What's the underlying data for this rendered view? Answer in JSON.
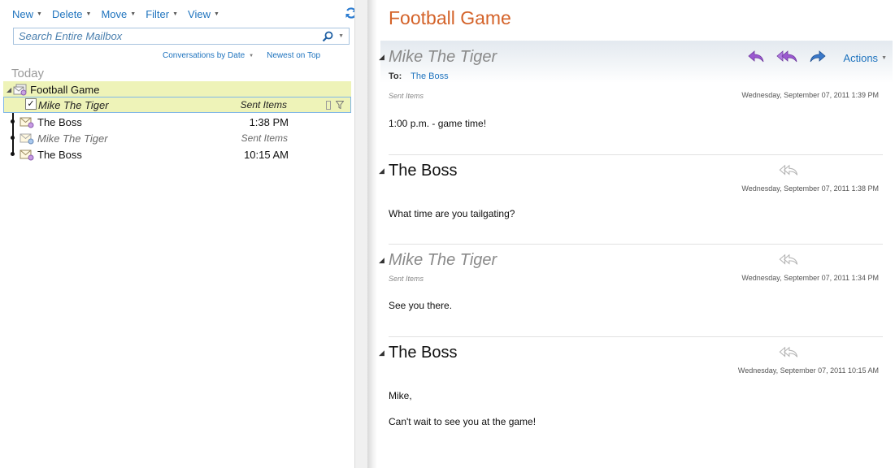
{
  "toolbar": {
    "new_label": "New",
    "delete_label": "Delete",
    "move_label": "Move",
    "filter_label": "Filter",
    "view_label": "View"
  },
  "search": {
    "placeholder": "Search Entire Mailbox"
  },
  "sortbar": {
    "arrange_label": "Conversations by Date",
    "order_label": "Newest on Top"
  },
  "list": {
    "group_label": "Today",
    "conversation_title": "Football Game",
    "messages": [
      {
        "sender": "Mike The Tiger",
        "meta": "Sent Items"
      },
      {
        "sender": "The Boss",
        "meta": "1:38 PM"
      },
      {
        "sender": "Mike The Tiger",
        "meta": "Sent Items"
      },
      {
        "sender": "The Boss",
        "meta": "10:15 AM"
      }
    ]
  },
  "reading": {
    "title": "Football Game",
    "actions_label": "Actions",
    "messages": [
      {
        "sender": "Mike The Tiger",
        "to_label": "To:",
        "to_value": "The Boss",
        "folder": "Sent Items",
        "date": "Wednesday, September 07, 2011 1:39 PM",
        "body": "1:00 p.m. - game time!"
      },
      {
        "sender": "The Boss",
        "date": "Wednesday, September 07, 2011 1:38 PM",
        "body": "What time are you tailgating?"
      },
      {
        "sender": "Mike The Tiger",
        "folder": "Sent Items",
        "date": "Wednesday, September 07, 2011 1:34 PM",
        "body": "See you there."
      },
      {
        "sender": "The Boss",
        "date": "Wednesday, September 07, 2011 10:15 AM",
        "body_line1": "Mike,",
        "body_line2": "Can't wait to see you at the game!"
      }
    ]
  },
  "colors": {
    "accent_blue": "#1e73be",
    "title_orange": "#d4632a",
    "highlight_yellow": "#eef3b8",
    "reply_purple": "#9b59d0",
    "forward_blue": "#3a78c9"
  },
  "icons": {
    "refresh": "refresh-icon",
    "search": "search-icon",
    "expand": "double-chevron-down-icon",
    "envelope": "envelope-icon",
    "reply": "reply-icon",
    "reply_all": "reply-all-icon",
    "forward": "forward-icon"
  }
}
